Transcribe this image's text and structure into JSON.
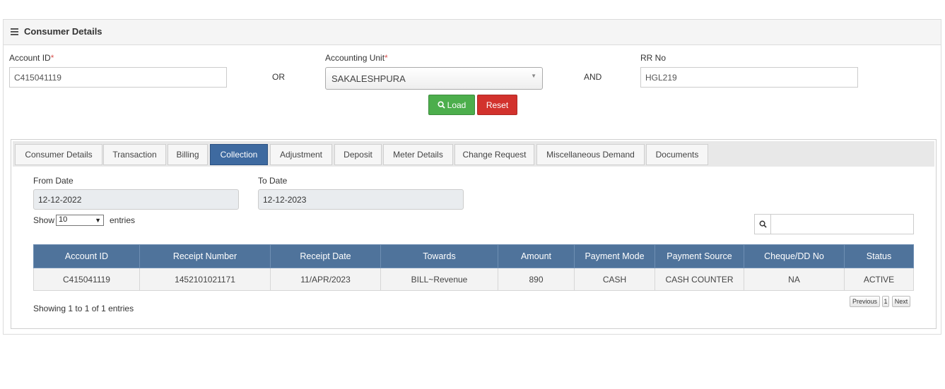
{
  "panel": {
    "title": "Consumer Details"
  },
  "search_form": {
    "account_id": {
      "label": "Account ID",
      "required_mark": "*",
      "value": "C415041119"
    },
    "or_text": "OR",
    "accounting_unit": {
      "label": "Accounting Unit",
      "required_mark": "*",
      "value": "SAKALESHPURA"
    },
    "and_text": "AND",
    "rr_no": {
      "label": "RR No",
      "value": "HGL219"
    },
    "load_label": "Load",
    "reset_label": "Reset"
  },
  "tabs": [
    {
      "label": "Consumer Details",
      "active": false
    },
    {
      "label": "Transaction",
      "active": false
    },
    {
      "label": "Billing",
      "active": false
    },
    {
      "label": "Collection",
      "active": true
    },
    {
      "label": "Adjustment",
      "active": false
    },
    {
      "label": "Deposit",
      "active": false
    },
    {
      "label": "Meter Details",
      "active": false
    },
    {
      "label": "Change Request",
      "active": false
    },
    {
      "label": "Miscellaneous Demand",
      "active": false
    },
    {
      "label": "Documents",
      "active": false
    }
  ],
  "collection": {
    "from_date": {
      "label": "From Date",
      "value": "12-12-2022"
    },
    "to_date": {
      "label": "To Date",
      "value": "12-12-2023"
    },
    "show_label": "Show",
    "entries_value": "10",
    "entries_label": "entries",
    "table": {
      "columns": [
        "Account ID",
        "Receipt Number",
        "Receipt Date",
        "Towards",
        "Amount",
        "Payment Mode",
        "Payment Source",
        "Cheque/DD No",
        "Status"
      ],
      "rows": [
        [
          "C415041119",
          "1452101021171",
          "11/APR/2023",
          "BILL~Revenue",
          "890",
          "CASH",
          "CASH COUNTER",
          "NA",
          "ACTIVE"
        ]
      ]
    },
    "info": "Showing 1 to 1 of 1 entries",
    "pagination": {
      "previous": "Previous",
      "page": "1",
      "next": "Next"
    }
  },
  "colors": {
    "tab_active": "#3e6aa0",
    "table_header": "#4f739b",
    "load_button": "#4cae4c",
    "reset_button": "#d2322d",
    "required": "#d9534f"
  },
  "icons": {
    "menu": "menu-icon",
    "load": "search-icon",
    "search": "search-icon",
    "dropdown": "chevron-down-icon"
  }
}
